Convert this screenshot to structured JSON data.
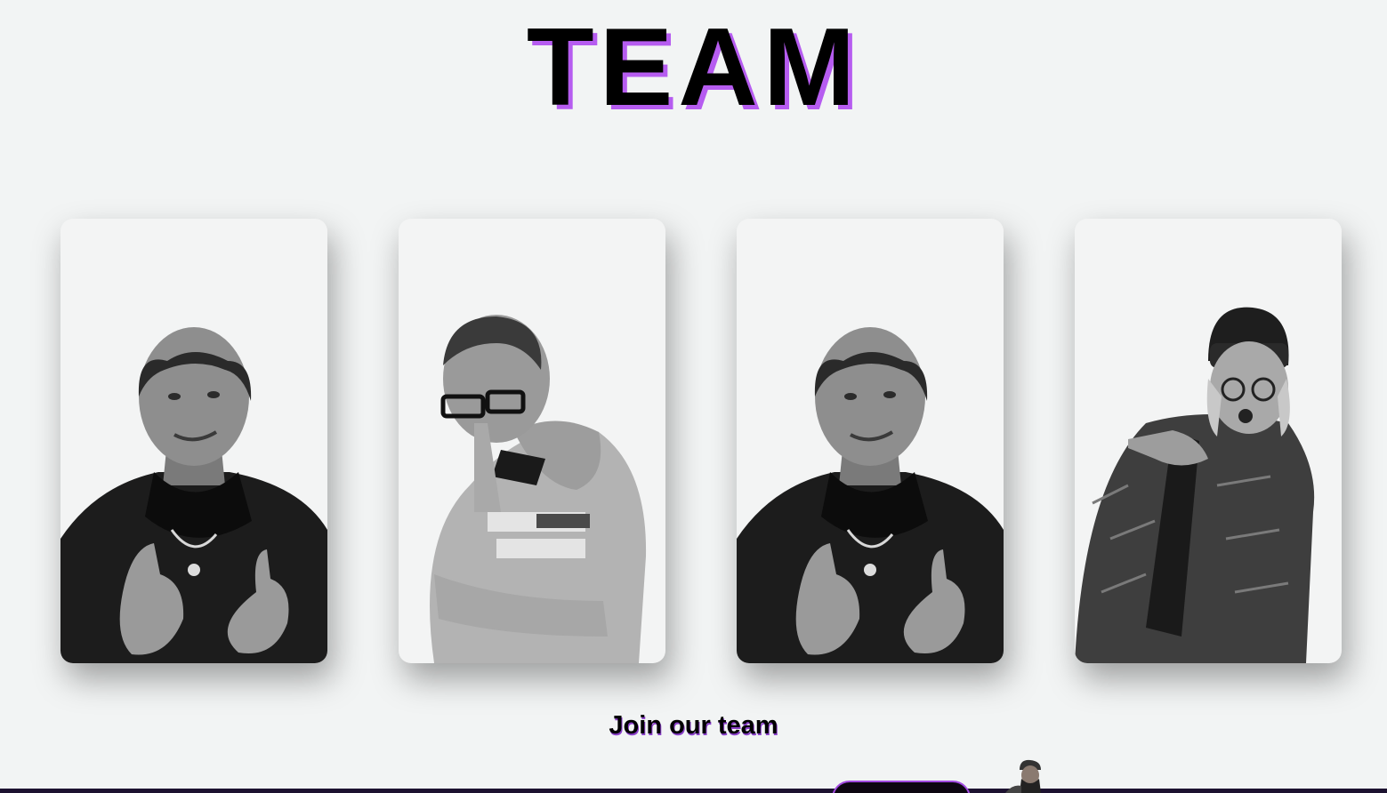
{
  "page": {
    "title": "TEAM",
    "join_label": "Join our team"
  },
  "colors": {
    "background": "#f2f4f4",
    "title": "#000000",
    "title_shadow": "#b65cf0",
    "accent": "#a24ae0"
  },
  "team": [
    {
      "photo": "grayscale-portrait-thumbs-up"
    },
    {
      "photo": "grayscale-portrait-glasses-hoodie"
    },
    {
      "photo": "grayscale-portrait-thumbs-up"
    },
    {
      "photo": "grayscale-portrait-beanie-pointing"
    }
  ]
}
